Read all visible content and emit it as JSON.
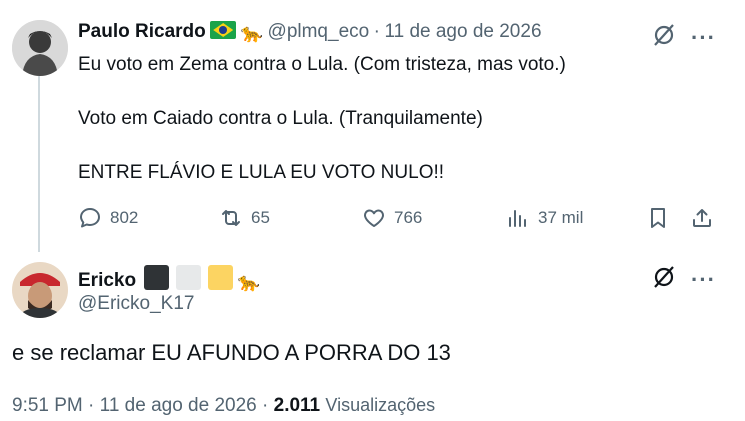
{
  "tweet1": {
    "author_name": "Paulo Ricardo",
    "flag_emoji": "brazil-flag",
    "leopard_emoji": "🐆",
    "handle": "@plmq_eco",
    "separator": "·",
    "date": "11 de ago de 2026",
    "lines": [
      "Eu voto em Zema contra o Lula. (Com tristeza, mas voto.)",
      "Voto em Caiado contra o Lula. (Tranquilamente)",
      "ENTRE FLÁVIO E LULA EU VOTO NULO!!"
    ],
    "replies": "802",
    "reposts": "65",
    "likes": "766",
    "views": "37 mil",
    "more_label": "···"
  },
  "tweet2": {
    "author_name": "Ericko",
    "square_colors": [
      "#2f3336",
      "#e7e9ea",
      "#fcd462"
    ],
    "leopard_emoji": "🐆",
    "handle": "@Ericko_K17",
    "text": "e se reclamar EU AFUNDO A PORRA DO 13",
    "time": "9:51 PM",
    "separator": "·",
    "date": "11 de ago de 2026",
    "separator2": "·",
    "views_count": "2.011",
    "views_label": "Visualizações",
    "more_label": "···"
  }
}
